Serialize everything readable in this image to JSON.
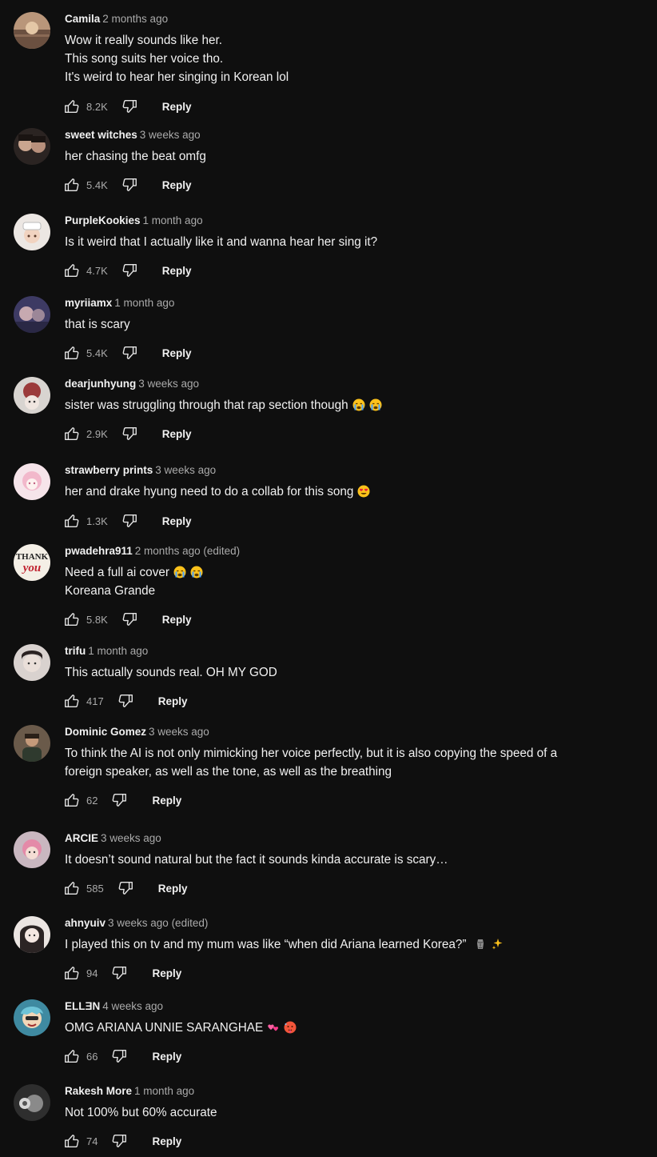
{
  "reply_label": "Reply",
  "comments": [
    {
      "author": "Camila",
      "time": "2 months ago",
      "lines": [
        "Wow it really sounds like her.",
        "This song suits her voice tho.",
        "It's weird to hear her singing in Korean lol"
      ],
      "likes": "8.2K",
      "avatar_color": "#8d6b4e"
    },
    {
      "author": "sweet witches",
      "time": "3 weeks ago",
      "lines": [
        "her chasing the beat omfg"
      ],
      "likes": "5.4K",
      "avatar_color": "#3a2f2c"
    },
    {
      "author": "PurpleKookies",
      "time": "1 month ago",
      "lines": [
        "Is it weird that I actually like it and wanna hear her sing it?"
      ],
      "likes": "4.7K",
      "avatar_color": "#e9e3df"
    },
    {
      "author": "myriiamx",
      "time": "1 month ago",
      "lines": [
        "that is scary"
      ],
      "likes": "5.4K",
      "avatar_color": "#4b4a72"
    },
    {
      "author": "dearjunhyung",
      "time": "3 weeks ago",
      "lines": [
        "sister was struggling through that rap section though"
      ],
      "emojis": [
        "crying-face-emoji",
        "crying-face-emoji"
      ],
      "likes": "2.9K",
      "avatar_color": "#7a3b3b"
    },
    {
      "author": "strawberry prints",
      "time": "3 weeks ago",
      "lines": [
        "her and drake hyung need to do a collab for this song"
      ],
      "emojis": [
        "heart-eyes-emoji"
      ],
      "likes": "1.3K",
      "avatar_color": "#f3dfe6"
    },
    {
      "author": "pwadehra911",
      "time": "2 months ago (edited)",
      "lines": [
        "Need a full ai cover",
        "Koreana Grande"
      ],
      "first_line_emojis": [
        "crying-face-emoji",
        "crying-face-emoji"
      ],
      "likes": "5.8K",
      "avatar_color": "#f4efe6",
      "avatar_text_1": "THANK",
      "avatar_text_2": "you"
    },
    {
      "author": "trifu",
      "time": "1 month ago",
      "lines": [
        "This actually sounds real. OH MY GOD"
      ],
      "likes": "417",
      "avatar_color": "#cfc8c8"
    },
    {
      "author": "Dominic Gomez",
      "time": "3 weeks ago",
      "text": "To think the AI is not only mimicking her voice perfectly, but it is also copying the speed of a foreign speaker, as well as the tone, as well as the breathing",
      "likes": "62",
      "avatar_color": "#5a4a3c"
    },
    {
      "author": "ARCIE",
      "time": "3 weeks ago",
      "lines": [
        "It doesn’t sound natural but the fact it sounds kinda accurate is scary…"
      ],
      "likes": "585",
      "avatar_color": "#d58ca8"
    },
    {
      "author": "ahnyuiv",
      "time": "3 weeks ago (edited)",
      "lines": [
        "I played this on tv and my mum was like “when did Ariana learned Korea?”"
      ],
      "emojis": [
        "moai-emoji",
        "sparkles-emoji"
      ],
      "likes": "94",
      "avatar_color": "#e6dfdc"
    },
    {
      "author": "ELLƎN",
      "time": "4 weeks ago",
      "lines": [
        "OMG ARIANA UNNIE SARANGHAE"
      ],
      "emojis": [
        "two-hearts-emoji",
        "hot-face-emoji"
      ],
      "likes": "66",
      "avatar_color": "#4b9ab0"
    },
    {
      "author": "Rakesh More",
      "time": "1 month ago",
      "lines": [
        "Not 100% but 60% accurate"
      ],
      "likes": "74",
      "avatar_color": "#3a3a3a"
    }
  ]
}
